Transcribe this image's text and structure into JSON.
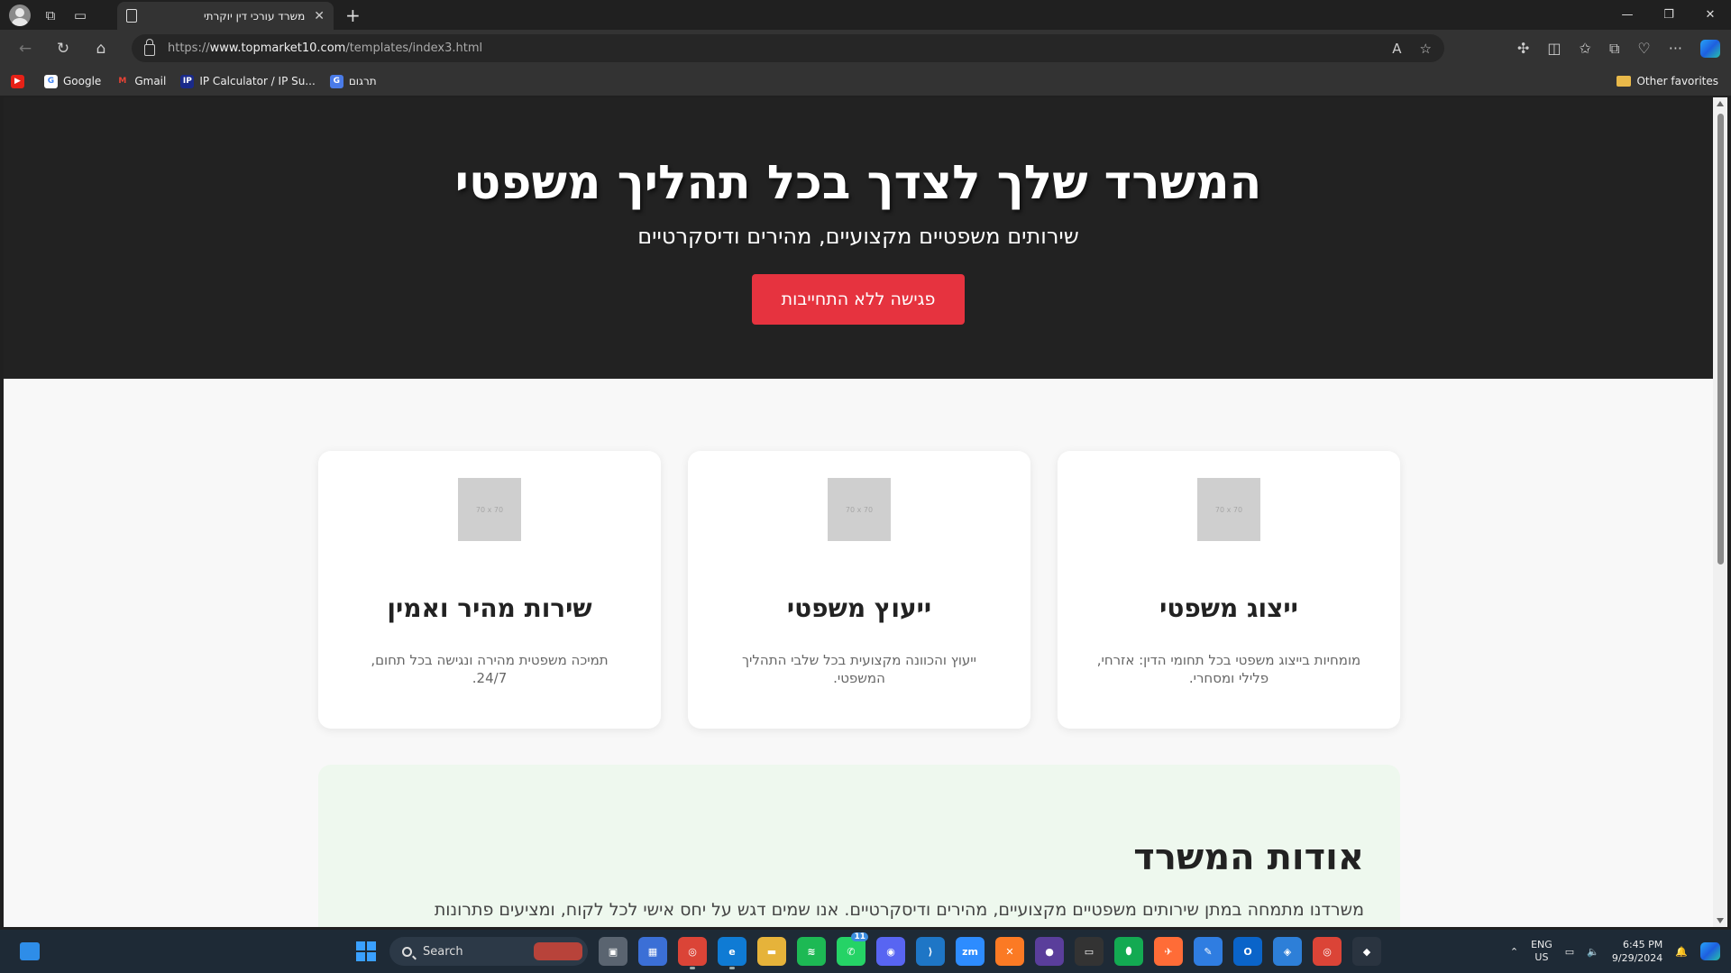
{
  "browser": {
    "tab_title": "משרד עורכי דין יוקרתי",
    "url_prefix": "https://",
    "url_host": "www.topmarket10.com",
    "url_path": "/templates/index3.html",
    "new_tab": "+",
    "favorites": [
      {
        "label": "",
        "icon": "youtube-icon",
        "color": "#e62117"
      },
      {
        "label": "Google",
        "icon": "google-icon",
        "color": "#ffffff"
      },
      {
        "label": "Gmail",
        "icon": "gmail-icon",
        "color": "#ea4335"
      },
      {
        "label": "IP Calculator / IP Su...",
        "icon": "ip-icon",
        "color": "#1a2a8a"
      },
      {
        "label": "תרגום",
        "icon": "translate-icon",
        "color": "#4a7be8"
      }
    ],
    "other_favorites": "Other favorites"
  },
  "hero": {
    "title": "המשרד שלך לצדך בכל תהליך משפטי",
    "subtitle": "שירותים משפטיים מקצועיים, מהירים ודיסקרטיים",
    "cta_label": "פגישה ללא התחייבות"
  },
  "cards": [
    {
      "placeholder": "70 x 70",
      "title": "ייצוג משפטי",
      "text": "מומחיות בייצוג משפטי בכל תחומי הדין: אזרחי, פלילי ומסחרי."
    },
    {
      "placeholder": "70 x 70",
      "title": "ייעוץ משפטי",
      "text": "ייעוץ והכוונה מקצועית בכל שלבי התהליך המשפטי."
    },
    {
      "placeholder": "70 x 70",
      "title": "שירות מהיר ואמין",
      "text": "תמיכה משפטית מהירה ונגישה בכל תחום, 24/7."
    }
  ],
  "about": {
    "title": "אודות המשרד",
    "text": "משרדנו מתמחה במתן שירותים משפטיים מקצועיים, מהירים ודיסקרטיים. אנו שמים דגש על יחס אישי לכל לקוח, ומציעים פתרונות"
  },
  "taskbar": {
    "search_label": "Search",
    "lang_line1": "ENG",
    "lang_line2": "US",
    "time": "6:45 PM",
    "date": "9/29/2024",
    "whatsapp_badge": "11"
  },
  "colors": {
    "hero_bg": "#222222",
    "cta": "#e6333f",
    "about_bg": "#eef8ee"
  }
}
